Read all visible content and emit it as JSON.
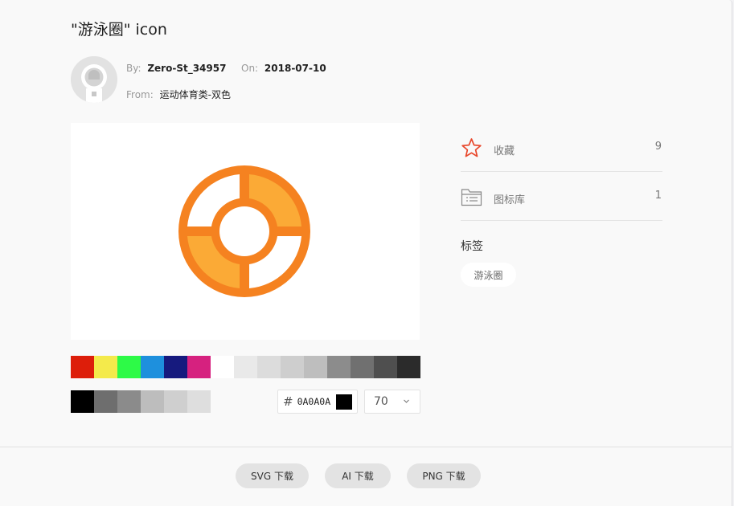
{
  "dialog": {
    "title": "\"游泳圈\" icon",
    "author_label": "By:",
    "author": "Zero-St_34957",
    "date_label": "On:",
    "date": "2018-07-10",
    "from_label": "From:",
    "from": "运动体育类-双色"
  },
  "preview": {
    "icon": "lifebuoy-icon",
    "colors": {
      "primary": "#F58220",
      "secondary": "#FBAA36",
      "inner": "#FFFFFF"
    }
  },
  "palette": {
    "row1": [
      "#DD1E0A",
      "#F4EA4B",
      "#2DFA47",
      "#1E90DD",
      "#161A7E",
      "#D6217F",
      "#FFFFFF",
      "#E9E9E9",
      "#DCDCDC",
      "#CECECE",
      "#BEBEBE",
      "#8C8C8C",
      "#707070",
      "#4F4F4F",
      "#2B2B2B"
    ],
    "row2": [
      "#000000",
      "#6E6E6E",
      "#8B8B8B",
      "#BDBDBD",
      "#CFCFCF",
      "#DEDEDE"
    ]
  },
  "color_input": {
    "hash": "#",
    "value": "0A0A0A",
    "swatch": "#000000"
  },
  "size_select": {
    "value": "70"
  },
  "sidebar": {
    "favorite": {
      "label": "收藏",
      "count": "9",
      "icon": "star-icon"
    },
    "library": {
      "label": "图标库",
      "count": "1",
      "icon": "folder-list-icon"
    },
    "tags_title": "标签",
    "tags": [
      "游泳圈"
    ]
  },
  "downloads": {
    "svg": "SVG 下载",
    "ai": "AI 下载",
    "png": "PNG 下载"
  }
}
